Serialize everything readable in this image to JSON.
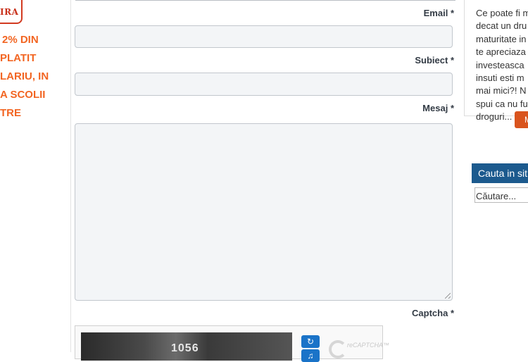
{
  "promo": {
    "logo_top": "%",
    "logo_bottom": "IRA",
    "lines": [
      "2% DIN",
      "PLATIT",
      "LARIU, IN",
      "A SCOLII",
      "TRE"
    ]
  },
  "form": {
    "email_label": "Email",
    "subject_label": "Subiect",
    "message_label": "Mesaj",
    "captcha_label": "Captcha",
    "required_mark": "*",
    "captcha_image_text": "1056",
    "recaptcha_brand": "reCAPTCHA™"
  },
  "article": {
    "lines": [
      "Ce poate fi m",
      "decat un dru",
      "maturitate in",
      "te apreciaza",
      "investeasca",
      "insuti esti m",
      "mai mici?! N",
      "spui ca nu fu",
      "droguri..."
    ],
    "more_label": "M"
  },
  "search": {
    "header": "Cauta in sit",
    "placeholder": "Căutare..."
  },
  "colors": {
    "promo_orange": "#f26522",
    "search_header_bg": "#1c5a8e",
    "more_button_bg": "#d9541e"
  }
}
